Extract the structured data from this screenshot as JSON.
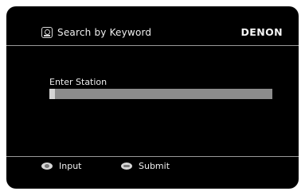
{
  "header": {
    "title": "Search by Keyword",
    "icon": "search-keyword-icon",
    "brand": "DENON"
  },
  "field": {
    "label": "Enter Station",
    "value": ""
  },
  "footer": {
    "input_label": "Input",
    "input_icon": "cursor-pad-icon",
    "submit_label": "Submit",
    "submit_icon": "enter-button-icon"
  },
  "colors": {
    "background": "#000000",
    "text": "#f0f0f0",
    "field": "#8c8c8c",
    "divider": "#9a9a9a"
  }
}
